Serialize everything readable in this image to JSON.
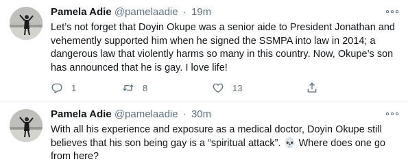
{
  "tweets": [
    {
      "author_name": "Pamela Adie",
      "handle": "@pamelaadie",
      "separator": "·",
      "time": "19m",
      "text": "Let’s not forget that Doyin Okupe was a senior aide to President Jonathan and vehemently supported him when he signed the SSMPA into law in 2014; a dangerous law that violently harms so many in this country. Now, Okupe’s son has announced that he is gay. I love life!",
      "reply_count": "1",
      "retweet_count": "8",
      "like_count": "13",
      "icons": [
        "more-icon",
        "reply-icon",
        "retweet-icon",
        "like-icon",
        "share-icon"
      ]
    },
    {
      "author_name": "Pamela Adie",
      "handle": "@pamelaadie",
      "separator": "·",
      "time": "30m",
      "text": "With all his experience and exposure as a medical doctor, Doyin Okupe still believes that his son being gay is a “spiritual attack”. 💀 Where does one go from here?",
      "icons": [
        "more-icon"
      ]
    }
  ],
  "colors": {
    "text": "#0f1419",
    "secondary": "#5b7083",
    "divider": "#e6ecf0"
  }
}
